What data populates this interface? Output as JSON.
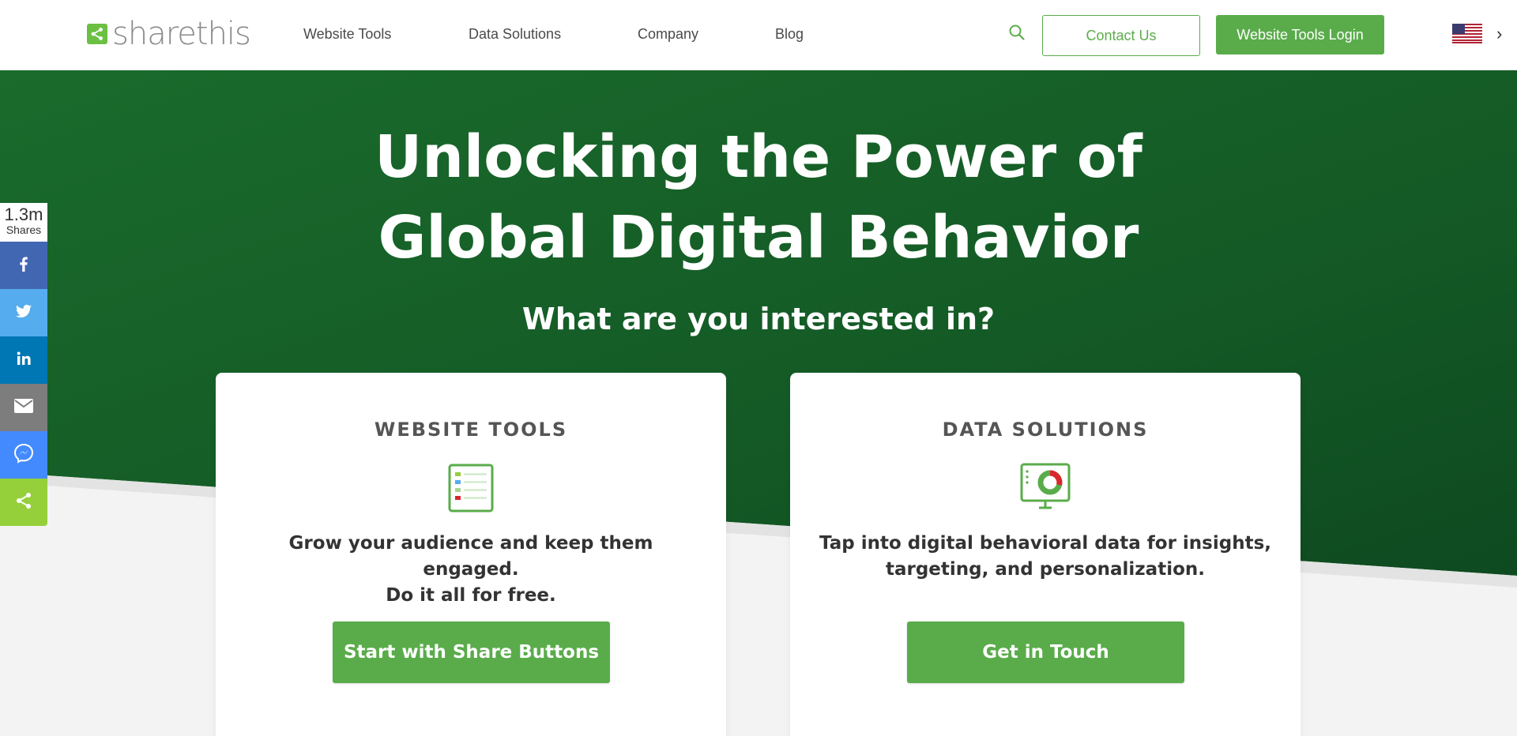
{
  "header": {
    "logo_text": "sharethis",
    "nav": [
      {
        "label": "Website Tools"
      },
      {
        "label": "Data Solutions"
      },
      {
        "label": "Company"
      },
      {
        "label": "Blog"
      }
    ],
    "contact_label": "Contact Us",
    "login_label": "Website Tools Login",
    "locale_flag": "us-flag-icon"
  },
  "hero": {
    "title_line1": "Unlocking the Power of",
    "title_line2": "Global Digital Behavior",
    "subtitle": "What are you interested in?"
  },
  "cards": [
    {
      "title": "WEBSITE TOOLS",
      "icon": "share-buttons-list-icon",
      "desc_line1": "Grow your audience and keep them engaged.",
      "desc_line2": "Do it all for free.",
      "button": "Start with Share Buttons"
    },
    {
      "title": "DATA SOLUTIONS",
      "icon": "analytics-monitor-icon",
      "desc_line1": "Tap into digital behavioral data for insights,",
      "desc_line2": "targeting, and personalization.",
      "button": "Get in Touch"
    }
  ],
  "share_bar": {
    "count": "1.3m",
    "count_label": "Shares",
    "buttons": [
      {
        "icon": "facebook-icon",
        "color": "#4267b2"
      },
      {
        "icon": "twitter-icon",
        "color": "#55acee"
      },
      {
        "icon": "linkedin-icon",
        "color": "#0077b5"
      },
      {
        "icon": "email-icon",
        "color": "#7d7d7d"
      },
      {
        "icon": "messenger-icon",
        "color": "#448aff"
      },
      {
        "icon": "share-icon",
        "color": "#95d03a"
      }
    ]
  },
  "colors": {
    "brand_green": "#5aac4b",
    "hero_green_dark": "#0e4a20",
    "hero_green": "#1a6b2c"
  }
}
